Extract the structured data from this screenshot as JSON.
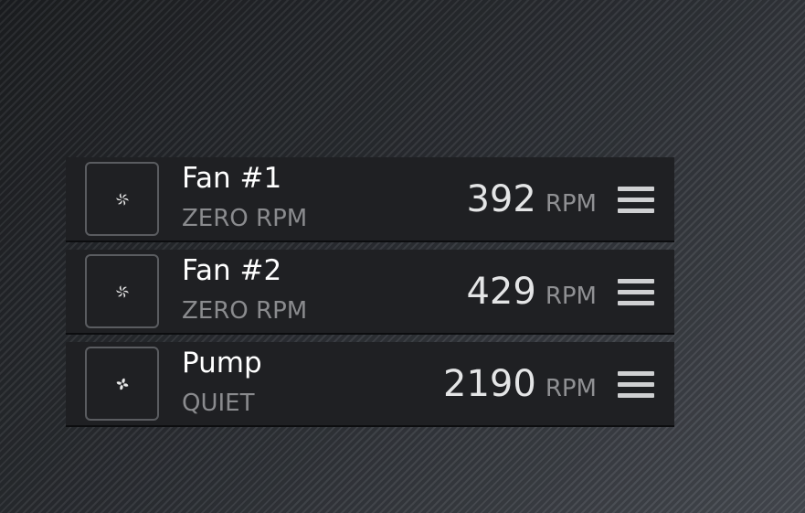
{
  "devices": [
    {
      "name": "Fan #1",
      "mode": "ZERO RPM",
      "speed": "392",
      "unit": "RPM",
      "icon": "fan-icon"
    },
    {
      "name": "Fan #2",
      "mode": "ZERO RPM",
      "speed": "429",
      "unit": "RPM",
      "icon": "fan-icon"
    },
    {
      "name": "Pump",
      "mode": "QUIET",
      "speed": "2190",
      "unit": "RPM",
      "icon": "pump-icon"
    }
  ],
  "colors": {
    "row_background": "#1f2023",
    "name_text": "#ffffff",
    "mode_text": "#8a8b8e",
    "speed_text": "#e4e5e6",
    "icon_border": "#5a5c60"
  }
}
